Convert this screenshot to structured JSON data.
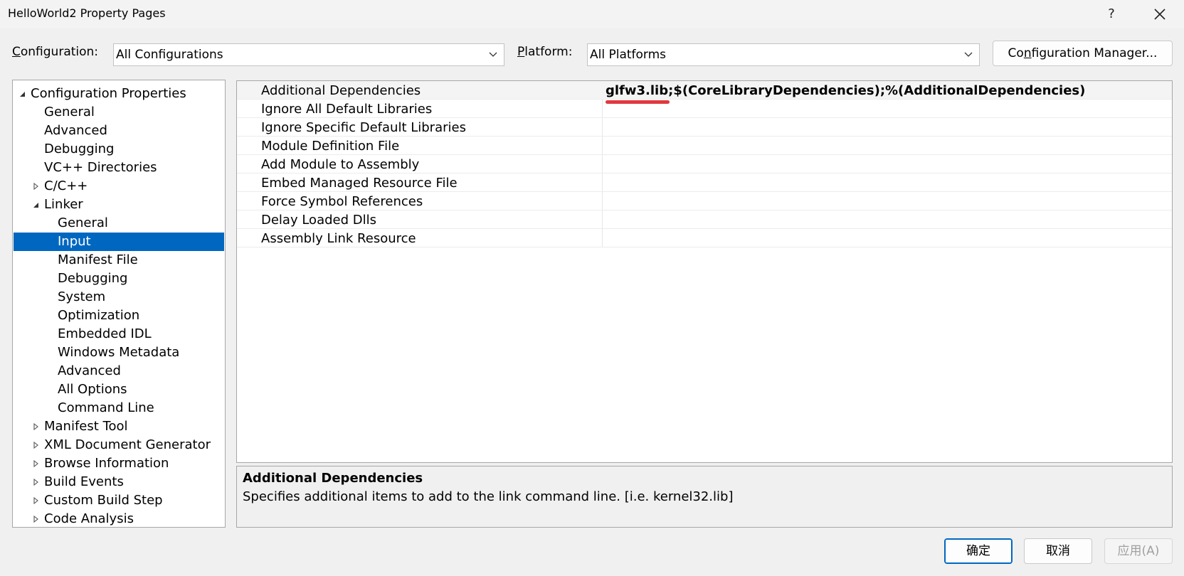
{
  "window": {
    "title": "HelloWorld2 Property Pages",
    "help_label": "?",
    "close_icon": "close-icon"
  },
  "toolbar": {
    "configuration_label_prefix": "C",
    "configuration_label_rest": "onfiguration:",
    "configuration_value": "All Configurations",
    "platform_label_prefix": "P",
    "platform_label_rest": "latform:",
    "platform_value": "All Platforms",
    "config_manager_prefix": "Co",
    "config_manager_accel": "n",
    "config_manager_rest": "figuration Manager..."
  },
  "tree": {
    "items": [
      {
        "label": "Configuration Properties",
        "expander": "expanded"
      },
      {
        "label": "General",
        "expander": "none"
      },
      {
        "label": "Advanced",
        "expander": "none"
      },
      {
        "label": "Debugging",
        "expander": "none"
      },
      {
        "label": "VC++ Directories",
        "expander": "none"
      },
      {
        "label": "C/C++",
        "expander": "collapsed"
      },
      {
        "label": "Linker",
        "expander": "expanded"
      },
      {
        "label": "General",
        "expander": "none"
      },
      {
        "label": "Input",
        "expander": "none",
        "selected": true
      },
      {
        "label": "Manifest File",
        "expander": "none"
      },
      {
        "label": "Debugging",
        "expander": "none"
      },
      {
        "label": "System",
        "expander": "none"
      },
      {
        "label": "Optimization",
        "expander": "none"
      },
      {
        "label": "Embedded IDL",
        "expander": "none"
      },
      {
        "label": "Windows Metadata",
        "expander": "none"
      },
      {
        "label": "Advanced",
        "expander": "none"
      },
      {
        "label": "All Options",
        "expander": "none"
      },
      {
        "label": "Command Line",
        "expander": "none"
      },
      {
        "label": "Manifest Tool",
        "expander": "collapsed"
      },
      {
        "label": "XML Document Generator",
        "expander": "collapsed"
      },
      {
        "label": "Browse Information",
        "expander": "collapsed"
      },
      {
        "label": "Build Events",
        "expander": "collapsed"
      },
      {
        "label": "Custom Build Step",
        "expander": "collapsed"
      },
      {
        "label": "Code Analysis",
        "expander": "collapsed"
      }
    ]
  },
  "grid": {
    "rows": [
      {
        "name": "Additional Dependencies",
        "value": "glfw3.lib;$(CoreLibraryDependencies);%(AdditionalDependencies)"
      },
      {
        "name": "Ignore All Default Libraries",
        "value": ""
      },
      {
        "name": "Ignore Specific Default Libraries",
        "value": ""
      },
      {
        "name": "Module Definition File",
        "value": ""
      },
      {
        "name": "Add Module to Assembly",
        "value": ""
      },
      {
        "name": "Embed Managed Resource File",
        "value": ""
      },
      {
        "name": "Force Symbol References",
        "value": ""
      },
      {
        "name": "Delay Loaded Dlls",
        "value": ""
      },
      {
        "name": "Assembly Link Resource",
        "value": ""
      }
    ]
  },
  "description": {
    "title": "Additional Dependencies",
    "text": "Specifies additional items to add to the link command line. [i.e. kernel32.lib]"
  },
  "buttons": {
    "ok": "确定",
    "cancel": "取消",
    "apply": "应用(A)"
  },
  "colors": {
    "selection": "#0067c0",
    "annotation": "#e2383f"
  }
}
